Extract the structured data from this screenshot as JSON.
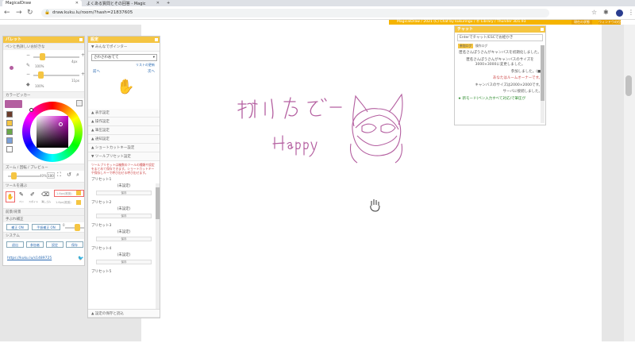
{
  "browser": {
    "tabs": [
      {
        "title": "MagicalDraw",
        "active": true
      },
      {
        "title": "よくある質問とその回答 - Magic",
        "active": false
      }
    ],
    "new_tab": "+",
    "url": "draw.kuku.lu/room/?hash=21837605",
    "back": "←",
    "forward": "→",
    "reload": "↻"
  },
  "infobar": {
    "text": "MagicalDraw / 2021 (C) Chat by kukuringu / Ⓡ Library / Thunder 3D1.93",
    "btn1": "現在の状態",
    "btn2": "ウィンドウの位置"
  },
  "palette": {
    "title": "パレット",
    "section_pen": "ペンと色詳しいお好きな",
    "size_value": "4px",
    "opacity_value": "100%",
    "size2_value": "11px",
    "opacity2_value": "100%",
    "section_color": "カラーピッカー",
    "section_zoom": "ズーム / 回転 / プレビュー",
    "zoom_value": "40%",
    "zoom_btn": "100",
    "section_tool": "ツールを選ぶ",
    "tool_labels": [
      "手",
      "ペン",
      "スポイト",
      "消しゴム"
    ],
    "tool_inputs": [
      "1.6px(推奨)",
      "1.6px(推奨)"
    ],
    "section_fg": "前景/背景",
    "section_hand": "手ぶれ補正",
    "hand_btn1": "補正 ON",
    "hand_btn2": "手振補正 ON",
    "hand_value": "0",
    "section_system": "システム",
    "sys_buttons": [
      "退出",
      "参加者",
      "設定",
      "保存"
    ],
    "link": "https://kuku.lu/s1489725",
    "colors": {
      "accent": "#f5c542",
      "pen": "#b45fa0"
    }
  },
  "settings": {
    "title": "設定",
    "pointer_header": "みんなでポインター",
    "pointer_select": "さわさわおてて",
    "pointer_link": "リストの更新",
    "prev": "前へ",
    "next": "次へ",
    "sections": [
      "表示設定",
      "操作設定",
      "筆圧設定",
      "通知設定",
      "ショートカットキー設定",
      "ツールプリセット設定"
    ],
    "preset_note": "ツールプリセットは複数のツールの種類や設定をまとめて保存できます。ショートカットキーや保存しキーで呼び出せる呼び出せます。",
    "presets": [
      {
        "label": "プリセット1",
        "value": "(未設定)",
        "btn": "保存"
      },
      {
        "label": "プリセット2",
        "value": "(未設定)",
        "btn": "保存"
      },
      {
        "label": "プリセット3",
        "value": "(未設定)",
        "btn": "保存"
      },
      {
        "label": "プリセット4",
        "value": "(未設定)",
        "btn": "保存"
      },
      {
        "label": "プリセット5",
        "value": "",
        "btn": ""
      }
    ],
    "footer": "設定の保存と読込"
  },
  "chat": {
    "title": "チャット",
    "input_placeholder": "Enterでチャット/ESCでお絵かき",
    "tabs": [
      "参加ログ",
      "操作ログ"
    ],
    "log": [
      "匿名さんぽうさんがキャンバスを初期化しました。",
      "匿名さんぽうさんがキャンバスのサイズを3000×3000に変更しました。",
      "参加しました。(■)",
      "あなたはルームオーナーです。",
      "キャンバスのサイズは2000×2000です。",
      "サーバに接続しました。",
      "★ 新モード(ペン入力すべて対応)で筆圧が"
    ]
  },
  "drawing": {
    "caption": "Happy",
    "title": "描けたぞー",
    "stroke": "#b45fa0"
  }
}
